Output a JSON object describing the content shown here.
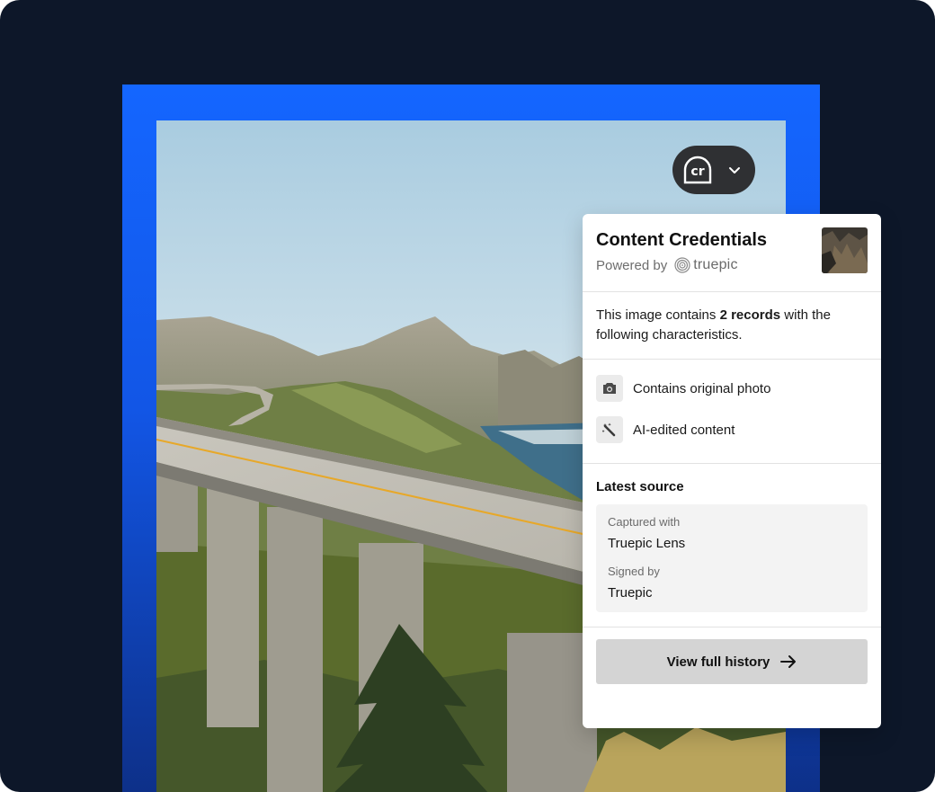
{
  "credentials_button": {
    "logo_icon": "cr-logo-icon",
    "chevron_icon": "chevron-down-icon"
  },
  "panel": {
    "title": "Content Credentials",
    "powered_by_label": "Powered by",
    "powered_by_brand": "truepic",
    "summary": {
      "prefix": "This image contains ",
      "count": "2 records",
      "suffix": " with the following characteristics."
    },
    "characteristics": [
      {
        "icon": "camera-icon",
        "label": "Contains original photo"
      },
      {
        "icon": "magic-wand-icon",
        "label": "AI-edited content"
      }
    ],
    "latest_source": {
      "title": "Latest source",
      "captured_with_label": "Captured with",
      "captured_with_value": "Truepic Lens",
      "signed_by_label": "Signed by",
      "signed_by_value": "Truepic"
    },
    "cta_label": "View full history"
  },
  "colors": {
    "stage_background": "#0d1729",
    "frame_blue": "#1466ff",
    "pill_background": "#2f3033",
    "cta_background": "#d4d4d4"
  }
}
